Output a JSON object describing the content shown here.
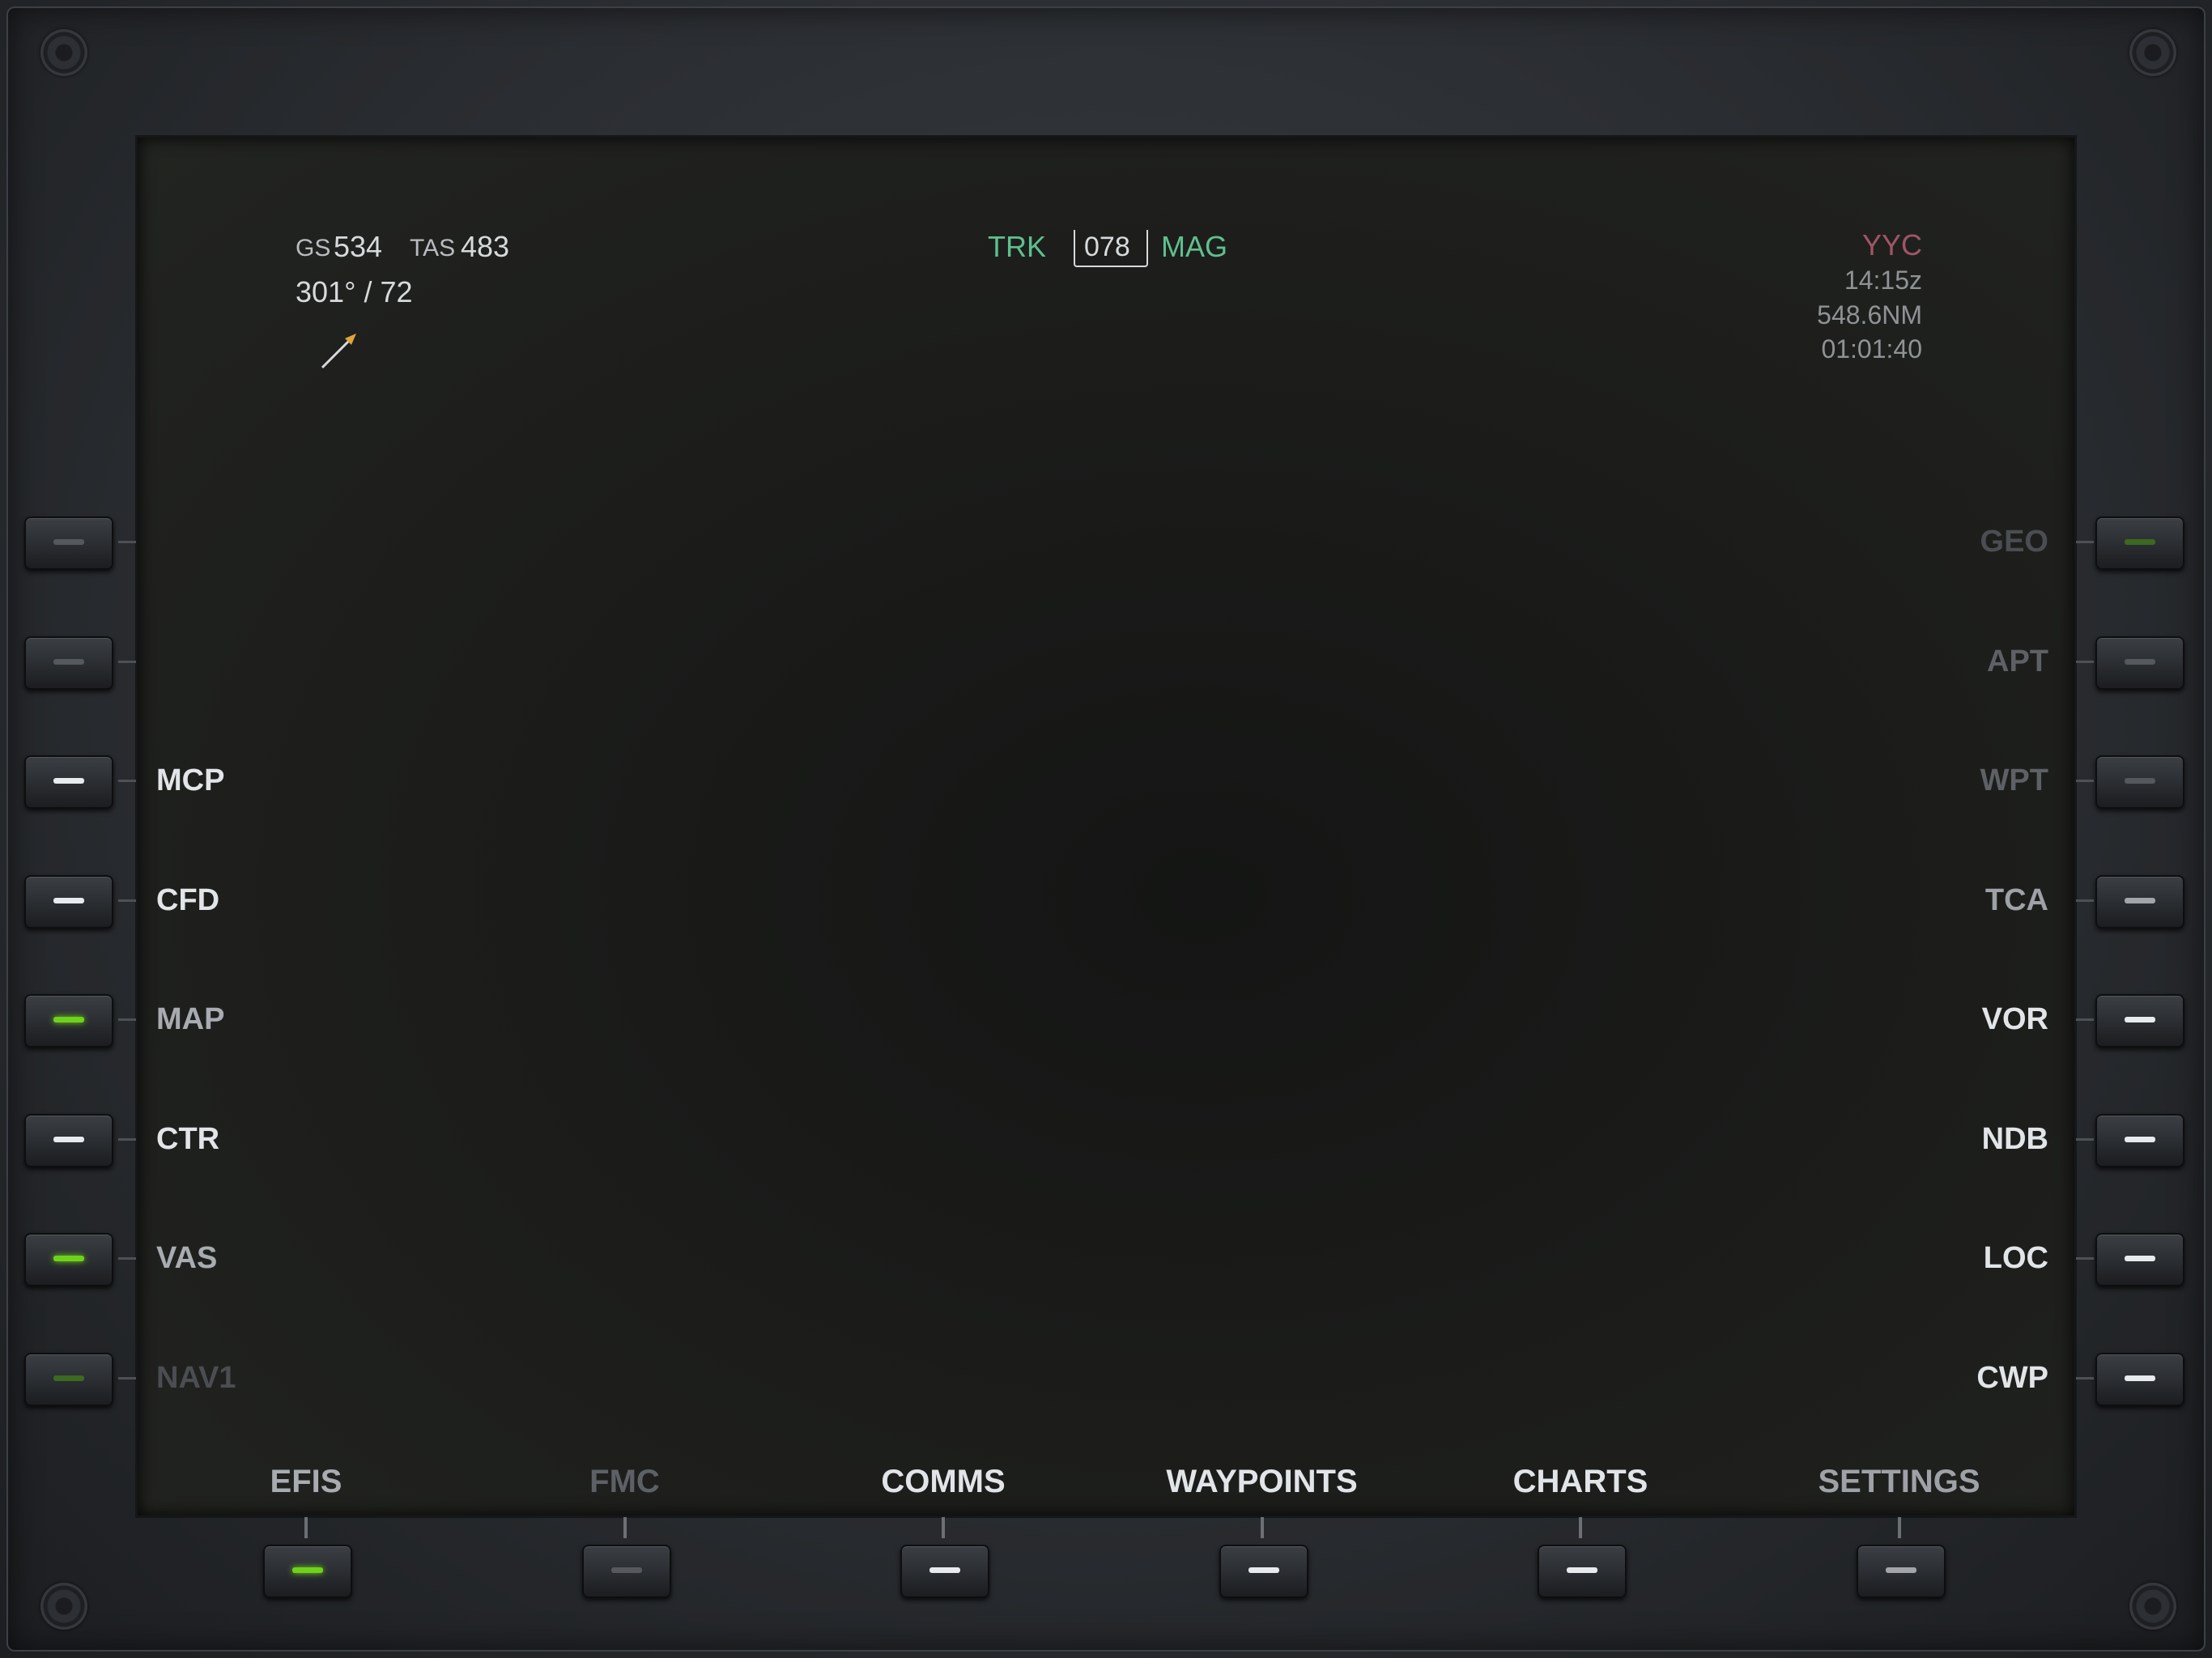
{
  "header": {
    "gs_label": "GS",
    "gs_value": "534",
    "tas_label": "TAS",
    "tas_value": "483",
    "wind": "301° / 72",
    "trk_label": "TRK",
    "trk_value": "078",
    "mag_label": "MAG",
    "dest": "YYC",
    "time_z": "14:15z",
    "distance": "548.6NM",
    "ete": "01:01:40"
  },
  "left_keys": [
    {
      "label": "",
      "state": "off"
    },
    {
      "label": "",
      "state": "off"
    },
    {
      "label": "MCP",
      "state": "white"
    },
    {
      "label": "CFD",
      "state": "white"
    },
    {
      "label": "MAP",
      "state": "green"
    },
    {
      "label": "CTR",
      "state": "white"
    },
    {
      "label": "VAS",
      "state": "green"
    },
    {
      "label": "NAV1",
      "state": "dim-green"
    }
  ],
  "right_keys": [
    {
      "label": "GEO",
      "state": "dim-green"
    },
    {
      "label": "APT",
      "state": "off"
    },
    {
      "label": "WPT",
      "state": "off"
    },
    {
      "label": "TCA",
      "state": "grey"
    },
    {
      "label": "VOR",
      "state": "white"
    },
    {
      "label": "NDB",
      "state": "white"
    },
    {
      "label": "LOC",
      "state": "white"
    },
    {
      "label": "CWP",
      "state": "white"
    }
  ],
  "bottom_keys": [
    {
      "label": "EFIS",
      "state": "green"
    },
    {
      "label": "FMC",
      "state": "off"
    },
    {
      "label": "COMMS",
      "state": "white"
    },
    {
      "label": "WAYPOINTS",
      "state": "white"
    },
    {
      "label": "CHARTS",
      "state": "white"
    },
    {
      "label": "SETTINGS",
      "state": "grey"
    }
  ],
  "colors": {
    "green_active": "#6fd21a",
    "white_active": "#e8ebee",
    "grey": "#a3a6a9",
    "off": "#55585c",
    "dim_green": "#3c6a20",
    "track_green": "#5fbf8f",
    "dest_red": "#a05566",
    "wind_arrow": "#e0a43a"
  },
  "icons": {
    "wind_arrow": "wind-direction-arrow-icon",
    "screw": "screw-icon"
  }
}
